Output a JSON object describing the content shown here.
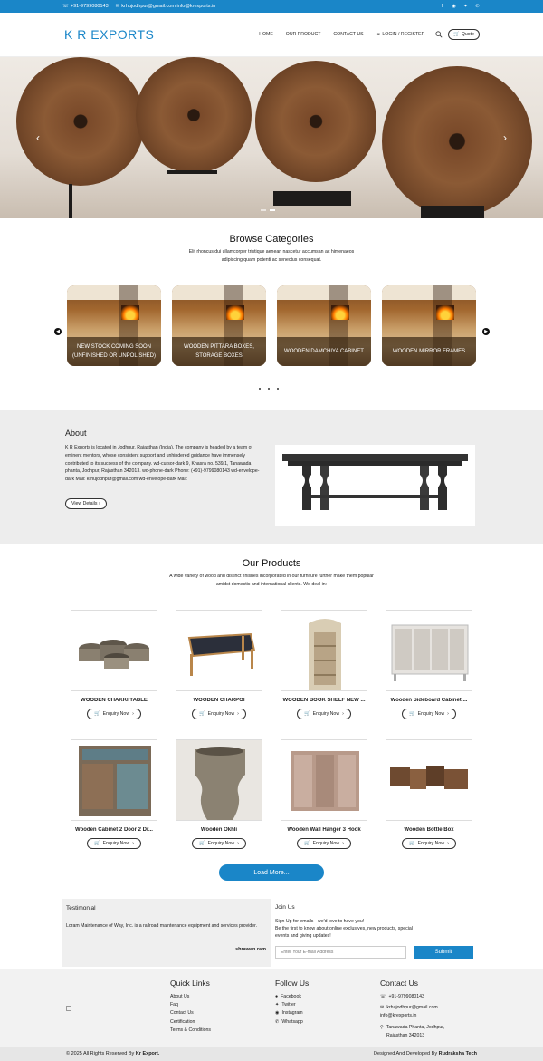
{
  "topbar": {
    "phone": "+91-9799080143",
    "email": "krhujodhpur@gmail.com info@krexports.in",
    "socials": [
      "facebook-icon",
      "instagram-icon",
      "twitter-icon",
      "whatsapp-icon"
    ]
  },
  "header": {
    "logo": "K R EXPORTS",
    "nav": [
      "HOME",
      "OUR PRODUCT",
      "CONTACT US",
      "LOGIN / REGISTER"
    ],
    "quote": "Quote"
  },
  "categories": {
    "title": "Browse Categories",
    "subtitle_line1": "Elit rhoncus dui ullamcorper tristique aenean nascetur accumsan ac himenaeos",
    "subtitle_line2": "adipiscing quam potenti ac senectus consequat.",
    "items": [
      {
        "label": "NEW STOCK COMING SOON (UNFINISHED OR UNPOLISHED)"
      },
      {
        "label": "WOODEN PITTARA BOXES, STORAGE BOXES"
      },
      {
        "label": "WOODEN DAMCHIYA CABINET"
      },
      {
        "label": "WOODEN MIRROR FRAMES"
      }
    ]
  },
  "about": {
    "title": "About",
    "text": "K R Exports is located in Jodhpur, Rajasthan (India). The company is headed by a team of eminent mentors, whose consistent support and unhindered guidance have immensely contributed to its success of the company. wd-cursor-dark 9, Khasra no. 539/1, Tanawada phanta, Jodhpur, Rajasthan 342013. wd-phone-dark Phone: (+91)-9799080143 wd-envelope-dark Mail: krhujodhpur@gmail.com wd-envelope-dark Mail:",
    "button": "View Details"
  },
  "products": {
    "title": "Our Products",
    "subtitle_line1": "A wide variety of wood and distinct finishes incorporated in our furniture further make them popular",
    "subtitle_line2": "amidst domestic and international clients. We deal in:",
    "enquiry_label": "Enquiry Now",
    "items": [
      {
        "name": "WOODEN CHAKKI TABLE"
      },
      {
        "name": "WOODEN CHARPOI"
      },
      {
        "name": "WOODEN BOOK SHELF NEW ..."
      },
      {
        "name": "Wooden Sideboard Cabinet ..."
      },
      {
        "name": "Wooden Cabinet 2 Door 2 Dr..."
      },
      {
        "name": "Wooden Okhli"
      },
      {
        "name": "Wooden Wall Hanger 3 Hook"
      },
      {
        "name": "Wooden Bottle Box"
      }
    ],
    "load_more": "Load More..."
  },
  "testimonial": {
    "title": "Testimonial",
    "text": "Loram Maintenance of Way, Inc. is a railroad maintenance equipment and services provider.",
    "author": "shrawan ram"
  },
  "join": {
    "title": "Join Us",
    "line1": "Sign Up for emails - we'd love to have you!",
    "line2": "Be the first to know about online exclusives, new products, special",
    "line3": "events and giving updates!",
    "placeholder": "Enter Your E-mail Address",
    "submit": "Submit"
  },
  "footer": {
    "quick_title": "Quick Links",
    "quick": [
      "About Us",
      "Faq",
      "Contact Us",
      "Certification",
      "Terms & Conditions"
    ],
    "follow_title": "Follow Us",
    "follow": [
      "Facebook",
      "Twitter",
      "Instagram",
      "Whatsapp"
    ],
    "contact_title": "Contact Us",
    "phone": "+91-9799080143",
    "email1": "krhujodhpur@gmail.com",
    "email2": "info@krexports.in",
    "address1": "Tanawada Phanta, Jodhpur,",
    "address2": "Rajasthan 342013"
  },
  "copyright": {
    "left_prefix": "© 2025 All Rights Reserved By",
    "left_brand": "Kr Export.",
    "right_prefix": "Designed And Developed By",
    "right_brand": "Rudraksha Tech"
  },
  "colors": {
    "brand": "#1a86c8"
  }
}
